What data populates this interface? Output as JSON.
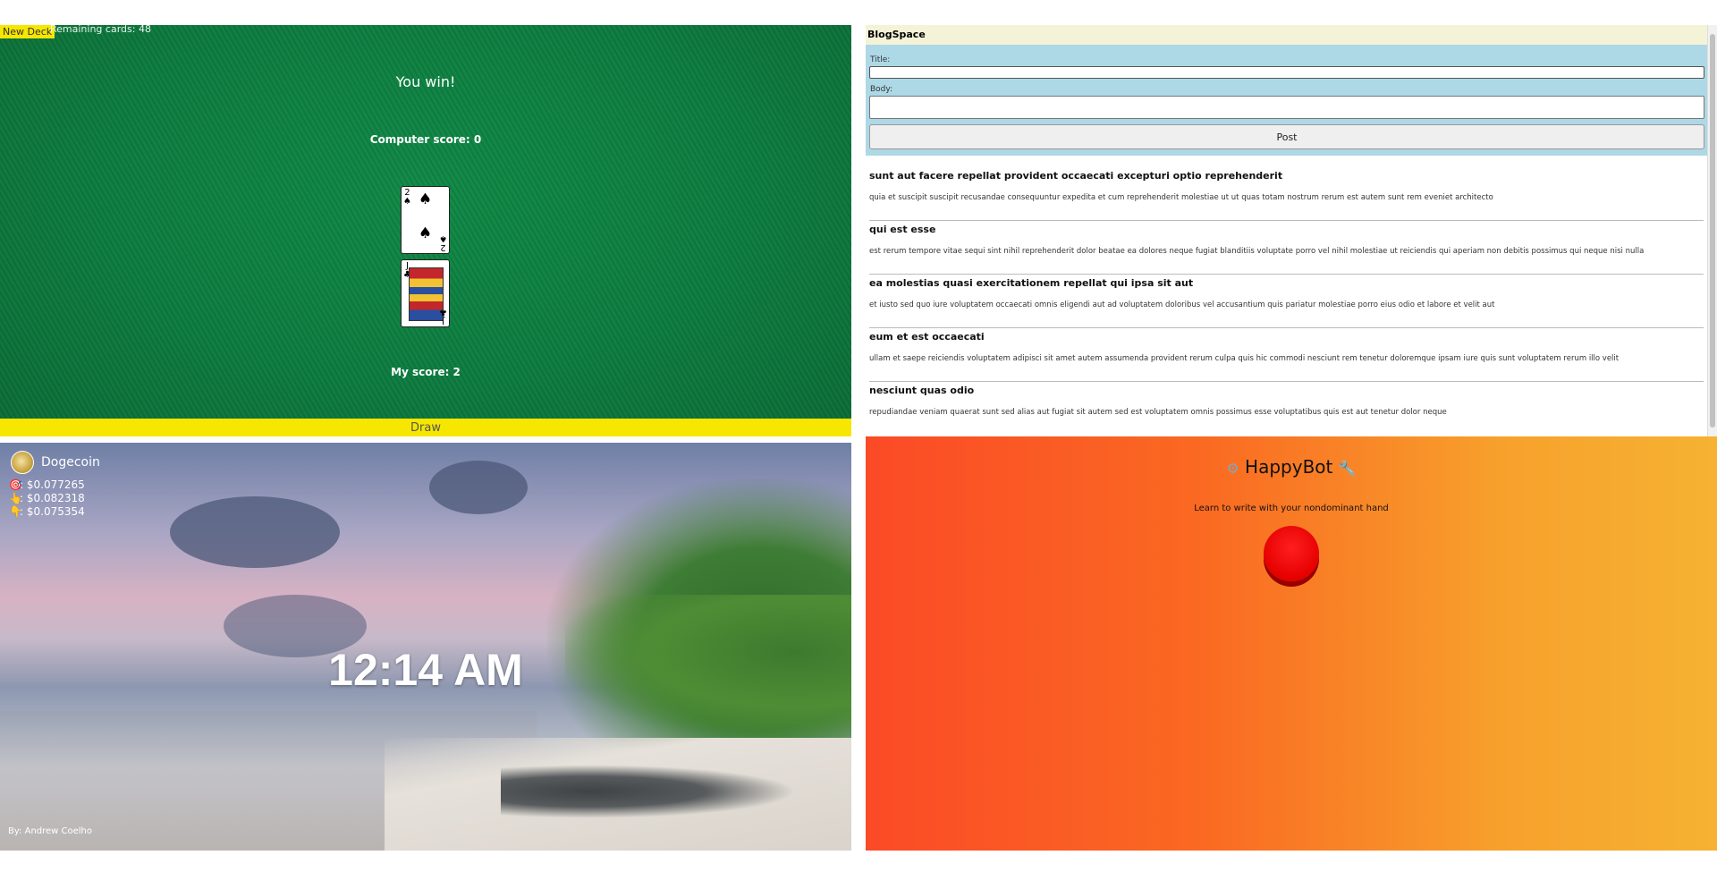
{
  "war_game": {
    "new_deck_label": "New Deck",
    "remaining": "Remaining cards: 48",
    "result": "You win!",
    "computer_score": "Computer score: 0",
    "my_score": "My score: 2",
    "draw_label": "Draw",
    "cards": [
      {
        "rank": "2",
        "suit": "♠"
      },
      {
        "rank": "J",
        "suit": "♣"
      }
    ]
  },
  "blog": {
    "site_name": "BlogSpace",
    "title_label": "Title:",
    "body_label": "Body:",
    "post_label": "Post",
    "posts": [
      {
        "title": "sunt aut facere repellat provident occaecati excepturi optio reprehenderit",
        "body": "quia et suscipit suscipit recusandae consequuntur expedita et cum reprehenderit molestiae ut ut quas totam nostrum rerum est autem sunt rem eveniet architecto"
      },
      {
        "title": "qui est esse",
        "body": "est rerum tempore vitae sequi sint nihil reprehenderit dolor beatae ea dolores neque fugiat blanditiis voluptate porro vel nihil molestiae ut reiciendis qui aperiam non debitis possimus qui neque nisi nulla"
      },
      {
        "title": "ea molestias quasi exercitationem repellat qui ipsa sit aut",
        "body": "et iusto sed quo iure voluptatem occaecati omnis eligendi aut ad voluptatem doloribus vel accusantium quis pariatur molestiae porro eius odio et labore et velit aut"
      },
      {
        "title": "eum et est occaecati",
        "body": "ullam et saepe reiciendis voluptatem adipisci sit amet autem assumenda provident rerum culpa quis hic commodi nesciunt rem tenetur doloremque ipsam iure quis sunt voluptatem rerum illo velit"
      },
      {
        "title": "nesciunt quas odio",
        "body": "repudiandae veniam quaerat sunt sed alias aut fugiat sit autem sed est voluptatem omnis possimus esse voluptatibus quis est aut tenetur dolor neque"
      }
    ]
  },
  "dashboard": {
    "coin_name": "Dogecoin",
    "prices": [
      {
        "icon": "target-icon",
        "glyph": "🎯",
        "value": ": $0.077265"
      },
      {
        "icon": "thumbs-up-icon",
        "glyph": "👆",
        "value": ": $0.082318"
      },
      {
        "icon": "thumbs-down-icon",
        "glyph": "👇",
        "value": ": $0.075354"
      }
    ],
    "time": "12:14 AM",
    "credit": "By: Andrew Coelho"
  },
  "happybot": {
    "title": "HappyBot",
    "subtitle": "Learn to write with your nondominant hand",
    "left_icon": "gear-icon",
    "right_icon": "wrench-icon"
  }
}
